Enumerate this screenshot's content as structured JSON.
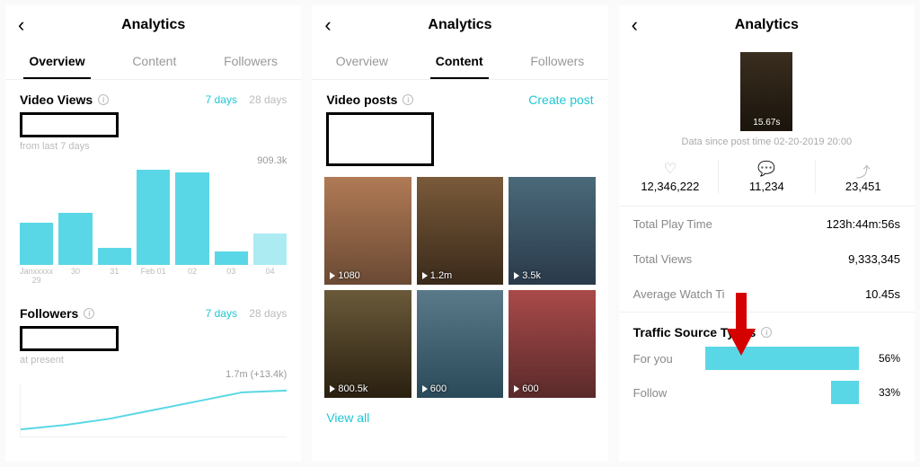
{
  "panels": {
    "overview": {
      "title": "Analytics",
      "tabs": [
        "Overview",
        "Content",
        "Followers"
      ],
      "active_tab": 0,
      "video_views": {
        "label": "Video Views",
        "range_active": "7 days",
        "range_inactive": "28 days",
        "subtext": "from last 7 days",
        "peak_label": "909.3k"
      },
      "followers": {
        "label": "Followers",
        "range_active": "7 days",
        "range_inactive": "28 days",
        "subtext": "at present",
        "peak_label": "1.7m (+13.4k)"
      }
    },
    "content": {
      "title": "Analytics",
      "tabs": [
        "Overview",
        "Content",
        "Followers"
      ],
      "active_tab": 1,
      "section_label": "Video posts",
      "create_label": "Create post",
      "thumbs": [
        {
          "views": "1080"
        },
        {
          "views": "1.2m"
        },
        {
          "views": "3.5k"
        },
        {
          "views": "800.5k"
        },
        {
          "views": "600"
        },
        {
          "views": "600"
        }
      ],
      "view_all": "View all"
    },
    "detail": {
      "title": "Analytics",
      "hero_duration": "15.67s",
      "since": "Data since post time 02-20-2019 20:00",
      "stats": {
        "likes": "12,346,222",
        "comments": "11,234",
        "shares": "23,451"
      },
      "rows": [
        {
          "k": "Total Play Time",
          "v": "123h:44m:56s"
        },
        {
          "k": "Total Views",
          "v": "9,333,345"
        },
        {
          "k": "Average Watch Ti",
          "v": "10.45s"
        }
      ],
      "traffic_label": "Traffic Source Types",
      "traffic": [
        {
          "label": "For you",
          "pct": 56
        },
        {
          "label": "Follow",
          "pct": 33
        }
      ]
    }
  },
  "chart_data": [
    {
      "type": "bar",
      "title": "Video Views",
      "categories": [
        "Janxxxxx 29",
        "30",
        "31",
        "Feb 01",
        "02",
        "03",
        "04"
      ],
      "values": [
        400000,
        500000,
        160000,
        909300,
        880000,
        130000,
        300000
      ],
      "ylim": [
        0,
        909300
      ],
      "ylabel": "views"
    },
    {
      "type": "line",
      "title": "Followers",
      "x": [
        1,
        2,
        3,
        4,
        5,
        6,
        7
      ],
      "values": [
        1450000,
        1480000,
        1520000,
        1580000,
        1640000,
        1690000,
        1700000
      ],
      "peak_label": "1.7m (+13.4k)"
    },
    {
      "type": "bar",
      "title": "Traffic Source Types",
      "orientation": "horizontal",
      "categories": [
        "For you",
        "Follow"
      ],
      "values": [
        56,
        33
      ],
      "ylim": [
        0,
        100
      ],
      "ylabel": "%"
    }
  ]
}
